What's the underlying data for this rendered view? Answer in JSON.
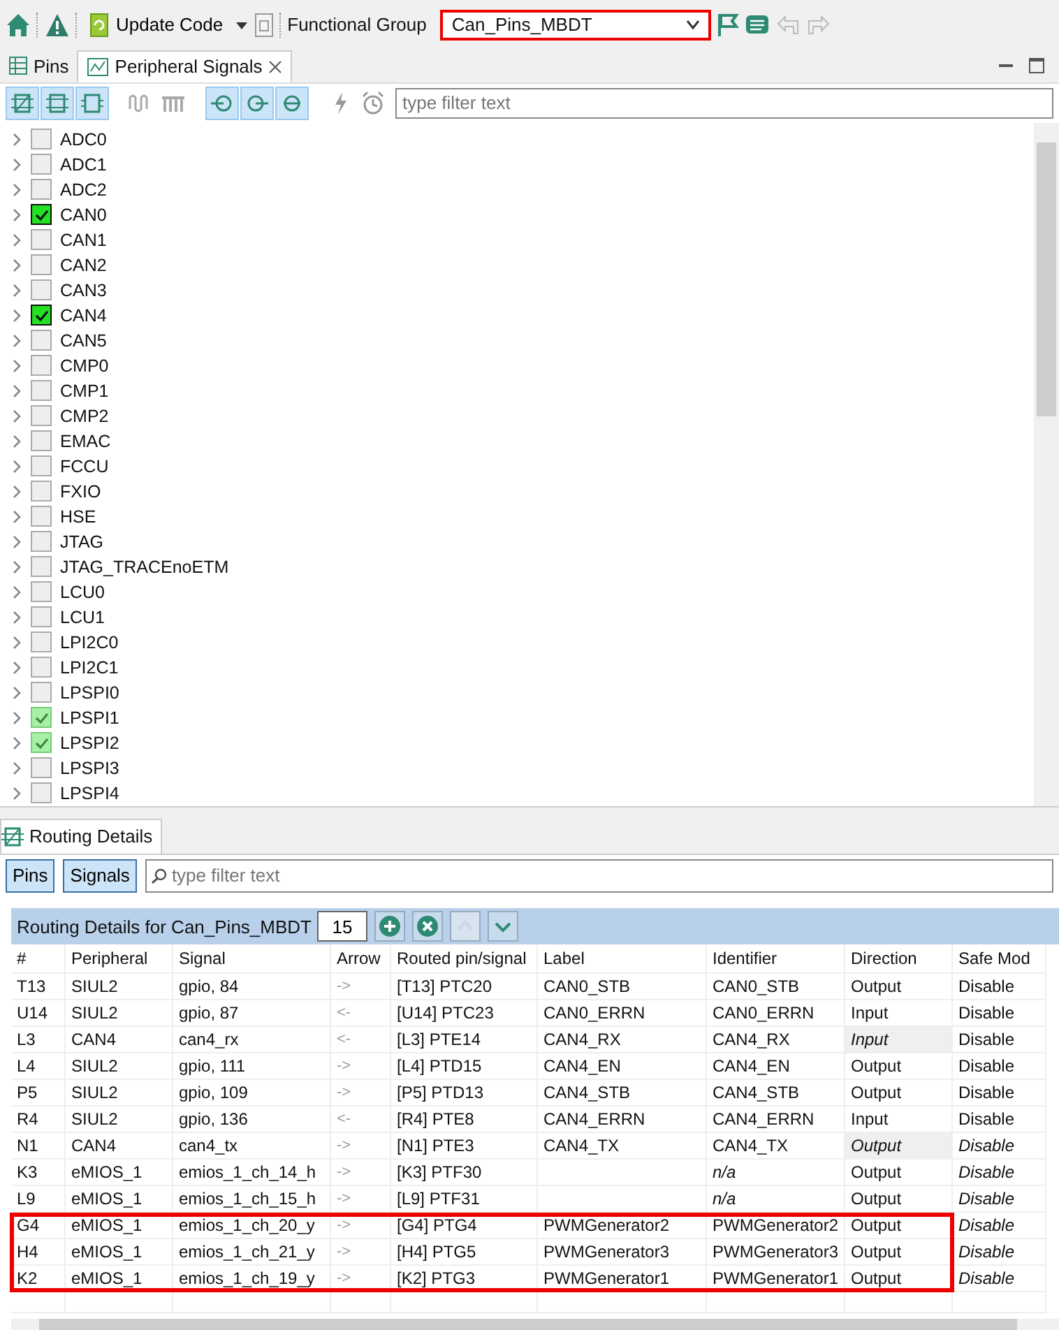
{
  "toolbar": {
    "update_code": "Update Code",
    "functional_group_label": "Functional Group",
    "functional_group": {
      "value": "Can_Pins_MBDT",
      "highlighted": true
    }
  },
  "tabs": [
    {
      "label": "Pins",
      "selected": false,
      "closable": false
    },
    {
      "label": "Peripheral Signals",
      "selected": true,
      "closable": true
    }
  ],
  "signal_filter": {
    "placeholder": "type filter text"
  },
  "peripherals": [
    {
      "label": "ADC0",
      "checked": false,
      "grayed": false
    },
    {
      "label": "ADC1",
      "checked": false,
      "grayed": false
    },
    {
      "label": "ADC2",
      "checked": false,
      "grayed": false
    },
    {
      "label": "CAN0",
      "checked": true,
      "grayed": false
    },
    {
      "label": "CAN1",
      "checked": false,
      "grayed": false
    },
    {
      "label": "CAN2",
      "checked": false,
      "grayed": false
    },
    {
      "label": "CAN3",
      "checked": false,
      "grayed": false
    },
    {
      "label": "CAN4",
      "checked": true,
      "grayed": false
    },
    {
      "label": "CAN5",
      "checked": false,
      "grayed": false
    },
    {
      "label": "CMP0",
      "checked": false,
      "grayed": false
    },
    {
      "label": "CMP1",
      "checked": false,
      "grayed": false
    },
    {
      "label": "CMP2",
      "checked": false,
      "grayed": false
    },
    {
      "label": "EMAC",
      "checked": false,
      "grayed": false
    },
    {
      "label": "FCCU",
      "checked": false,
      "grayed": false
    },
    {
      "label": "FXIO",
      "checked": false,
      "grayed": false
    },
    {
      "label": "HSE",
      "checked": false,
      "grayed": false
    },
    {
      "label": "JTAG",
      "checked": false,
      "grayed": false
    },
    {
      "label": "JTAG_TRACEnoETM",
      "checked": false,
      "grayed": false
    },
    {
      "label": "LCU0",
      "checked": false,
      "grayed": false
    },
    {
      "label": "LCU1",
      "checked": false,
      "grayed": false
    },
    {
      "label": "LPI2C0",
      "checked": false,
      "grayed": false
    },
    {
      "label": "LPI2C1",
      "checked": false,
      "grayed": false
    },
    {
      "label": "LPSPI0",
      "checked": false,
      "grayed": false
    },
    {
      "label": "LPSPI1",
      "checked": true,
      "grayed": true
    },
    {
      "label": "LPSPI2",
      "checked": true,
      "grayed": true
    },
    {
      "label": "LPSPI3",
      "checked": false,
      "grayed": false
    },
    {
      "label": "LPSPI4",
      "checked": false,
      "grayed": false
    }
  ],
  "routing": {
    "tab": "Routing Details",
    "view_buttons": [
      {
        "label": "Pins",
        "selected": true
      },
      {
        "label": "Signals",
        "selected": true
      }
    ],
    "filter": {
      "placeholder": "type filter text"
    },
    "title": "Routing Details for Can_Pins_MBDT",
    "count": "15",
    "columns": [
      "#",
      "Peripheral",
      "Signal",
      "Arrow",
      "Routed pin/signal",
      "Label",
      "Identifier",
      "Direction",
      "Safe Mod"
    ],
    "rows": [
      {
        "cells": [
          "T13",
          "SIUL2",
          "gpio, 84",
          "->",
          "[T13] PTC20",
          "CAN0_STB",
          "CAN0_STB",
          "Output",
          "Disable"
        ],
        "identifier_italic": false,
        "direction_italic": false,
        "direction_shaded": false,
        "safe_italic": false,
        "highlighted": false
      },
      {
        "cells": [
          "U14",
          "SIUL2",
          "gpio, 87",
          "<-",
          "[U14] PTC23",
          "CAN0_ERRN",
          "CAN0_ERRN",
          "Input",
          "Disable"
        ],
        "identifier_italic": false,
        "direction_italic": false,
        "direction_shaded": false,
        "safe_italic": false,
        "highlighted": false
      },
      {
        "cells": [
          "L3",
          "CAN4",
          "can4_rx",
          "<-",
          "[L3] PTE14",
          "CAN4_RX",
          "CAN4_RX",
          "Input",
          "Disable"
        ],
        "identifier_italic": false,
        "direction_italic": true,
        "direction_shaded": true,
        "safe_italic": false,
        "highlighted": false
      },
      {
        "cells": [
          "L4",
          "SIUL2",
          "gpio, 111",
          "->",
          "[L4] PTD15",
          "CAN4_EN",
          "CAN4_EN",
          "Output",
          "Disable"
        ],
        "identifier_italic": false,
        "direction_italic": false,
        "direction_shaded": false,
        "safe_italic": false,
        "highlighted": false
      },
      {
        "cells": [
          "P5",
          "SIUL2",
          "gpio, 109",
          "->",
          "[P5] PTD13",
          "CAN4_STB",
          "CAN4_STB",
          "Output",
          "Disable"
        ],
        "identifier_italic": false,
        "direction_italic": false,
        "direction_shaded": false,
        "safe_italic": false,
        "highlighted": false
      },
      {
        "cells": [
          "R4",
          "SIUL2",
          "gpio, 136",
          "<-",
          "[R4] PTE8",
          "CAN4_ERRN",
          "CAN4_ERRN",
          "Input",
          "Disable"
        ],
        "identifier_italic": false,
        "direction_italic": false,
        "direction_shaded": false,
        "safe_italic": false,
        "highlighted": false
      },
      {
        "cells": [
          "N1",
          "CAN4",
          "can4_tx",
          "->",
          "[N1] PTE3",
          "CAN4_TX",
          "CAN4_TX",
          "Output",
          "Disable"
        ],
        "identifier_italic": false,
        "direction_italic": true,
        "direction_shaded": true,
        "safe_italic": true,
        "highlighted": false
      },
      {
        "cells": [
          "K3",
          "eMIOS_1",
          "emios_1_ch_14_h",
          "->",
          "[K3] PTF30",
          "",
          "n/a",
          "Output",
          "Disable"
        ],
        "identifier_italic": true,
        "direction_italic": false,
        "direction_shaded": false,
        "safe_italic": true,
        "highlighted": false
      },
      {
        "cells": [
          "L9",
          "eMIOS_1",
          "emios_1_ch_15_h",
          "->",
          "[L9] PTF31",
          "",
          "n/a",
          "Output",
          "Disable"
        ],
        "identifier_italic": true,
        "direction_italic": false,
        "direction_shaded": false,
        "safe_italic": true,
        "highlighted": false
      },
      {
        "cells": [
          "G4",
          "eMIOS_1",
          "emios_1_ch_20_y",
          "->",
          "[G4] PTG4",
          "PWMGenerator2",
          "PWMGenerator2",
          "Output",
          "Disable"
        ],
        "identifier_italic": false,
        "direction_italic": false,
        "direction_shaded": false,
        "safe_italic": true,
        "highlighted": true
      },
      {
        "cells": [
          "H4",
          "eMIOS_1",
          "emios_1_ch_21_y",
          "->",
          "[H4] PTG5",
          "PWMGenerator3",
          "PWMGenerator3",
          "Output",
          "Disable"
        ],
        "identifier_italic": false,
        "direction_italic": false,
        "direction_shaded": false,
        "safe_italic": true,
        "highlighted": true
      },
      {
        "cells": [
          "K2",
          "eMIOS_1",
          "emios_1_ch_19_y",
          "->",
          "[K2] PTG3",
          "PWMGenerator1",
          "PWMGenerator1",
          "Output",
          "Disable"
        ],
        "identifier_italic": false,
        "direction_italic": false,
        "direction_shaded": false,
        "safe_italic": true,
        "highlighted": true
      }
    ]
  }
}
